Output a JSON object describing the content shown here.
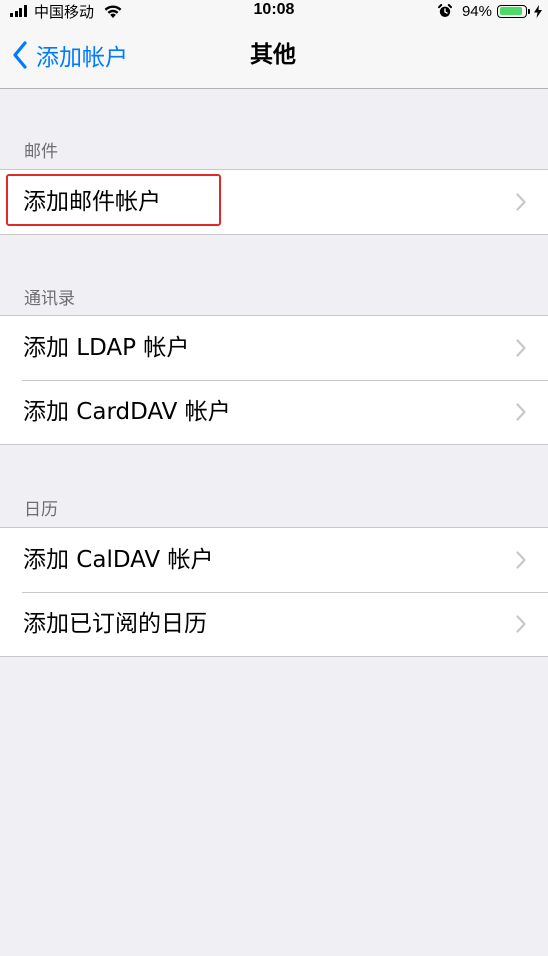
{
  "status_bar": {
    "carrier": "中国移动",
    "time": "10:08",
    "battery_percent": "94%",
    "battery_level": 0.94,
    "signal_bars": 4,
    "icons": [
      "signal-icon",
      "wifi-icon",
      "alarm-icon",
      "battery-icon",
      "charging-bolt-icon"
    ]
  },
  "nav": {
    "back_label": "添加帐户",
    "title": "其他"
  },
  "sections": {
    "mail": {
      "header": "邮件",
      "items": [
        "添加邮件帐户"
      ]
    },
    "contacts": {
      "header": "通讯录",
      "items": [
        "添加 LDAP 帐户",
        "添加 CardDAV 帐户"
      ]
    },
    "calendar": {
      "header": "日历",
      "items": [
        "添加 CalDAV 帐户",
        "添加已订阅的日历"
      ]
    }
  },
  "colors": {
    "accent": "#007aff",
    "highlight": "#e02a2a",
    "battery": "#4cd964",
    "background": "#efeff4"
  }
}
